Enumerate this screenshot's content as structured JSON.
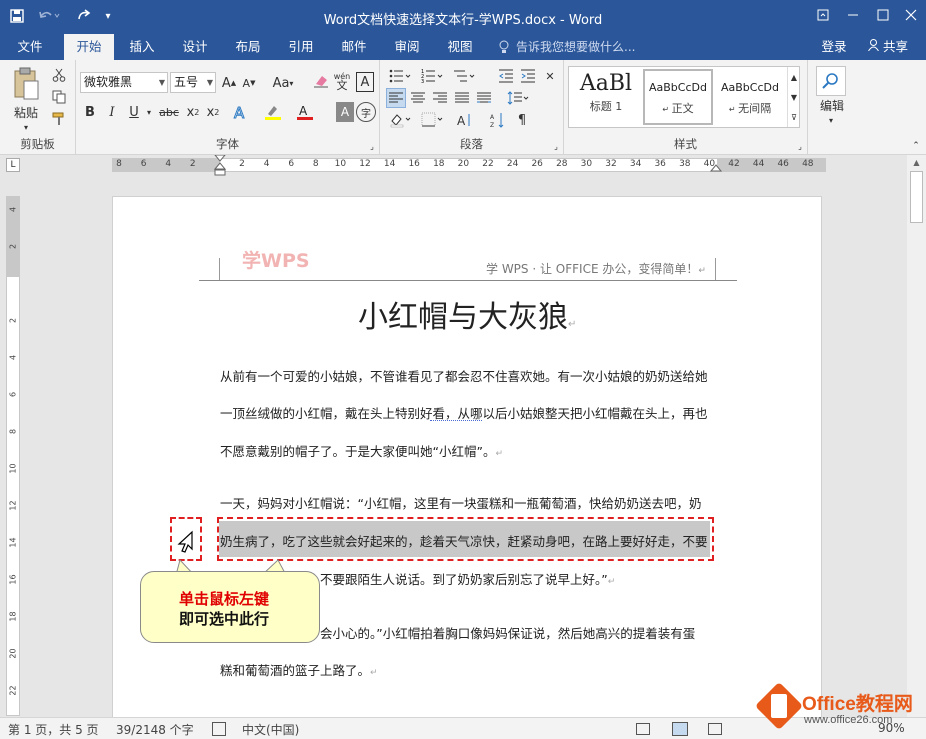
{
  "window": {
    "title": "Word文档快速选择文本行-学WPS.docx - Word"
  },
  "quick_access": {
    "save": "save-icon",
    "undo": "undo-icon",
    "redo": "redo-icon",
    "customize": "customize-icon"
  },
  "window_controls": [
    "restore-ribbon-icon",
    "minimize-icon",
    "maximize-icon",
    "close-icon"
  ],
  "tabs": [
    "文件",
    "开始",
    "插入",
    "设计",
    "布局",
    "引用",
    "邮件",
    "审阅",
    "视图"
  ],
  "tellme": "告诉我您想要做什么...",
  "login": "登录",
  "share": "共享",
  "ribbon": {
    "clipboard": {
      "paste": "粘贴",
      "label": "剪贴板"
    },
    "font": {
      "family": "微软雅黑",
      "size": "五号",
      "grow": "A",
      "shrink": "A",
      "case": "Aa",
      "phonetic": "wén",
      "bold": "B",
      "italic": "I",
      "underline": "U",
      "strike": "abc",
      "sub": "x",
      "sup": "x",
      "label": "字体"
    },
    "paragraph": {
      "label": "段落"
    },
    "styles": {
      "items": [
        {
          "preview": "AaBl",
          "name": "标题 1"
        },
        {
          "preview": "AaBbCcDd",
          "name": "正文"
        },
        {
          "preview": "AaBbCcDd",
          "name": "无间隔"
        }
      ],
      "label": "样式"
    },
    "editing": {
      "label": "编辑"
    }
  },
  "ruler_h": [
    "8",
    "6",
    "4",
    "2",
    "",
    "2",
    "4",
    "6",
    "8",
    "10",
    "12",
    "14",
    "16",
    "18",
    "20",
    "22",
    "24",
    "26",
    "28",
    "30",
    "32",
    "34",
    "36",
    "38",
    "40",
    "42",
    "44",
    "46",
    "48"
  ],
  "ruler_v": [
    "4",
    "2",
    "",
    "2",
    "4",
    "6",
    "8",
    "10",
    "12",
    "14",
    "16",
    "18",
    "20",
    "22"
  ],
  "document": {
    "header_logo": "学WPS",
    "header_slogan": "学 WPS · 让 OFFICE 办公，变得简单！",
    "title": "小红帽与大灰狼",
    "lines": [
      "从前有一个可爱的小姑娘，不管谁看见了都会忍不住喜欢她。有一次小姑娘的奶奶送给她",
      "一顶丝绒做的小红帽，戴在头上特别好看，从哪以后小姑娘整天把小红帽戴在头上，再也",
      "不愿意戴别的帽子了。于是大家便叫她“小红帽”。",
      "一天，妈妈对小红帽说：“小红帽，这里有一块蛋糕和一瓶葡萄酒，快给奶奶送去吧，奶",
      "奶生病了，吃了这些就会好起来的，趁着天气凉快，赶紧动身吧，在路上要好好走，不要",
      "不要跟陌生人说话。到了奶奶家后别忘了说早上好。”",
      "会小心的。”小红帽拍着胸口像妈妈保证说，然后她高兴的提着装有蛋",
      "糕和葡萄酒的篮子上路了。"
    ]
  },
  "callout": {
    "line1": "单击鼠标左键",
    "line2": "即可选中此行"
  },
  "status": {
    "page": "第 1 页，共 5 页",
    "words": "39/2148 个字",
    "lang": "中文(中国)",
    "zoom": "90%"
  },
  "watermark": {
    "brand": "Office教程网",
    "url": "www.office26.com"
  },
  "colors": {
    "titlebar": "#2b579a",
    "selection": "#c8c8c8",
    "highlight_box": "#e02020",
    "callout_title": "#e00000"
  }
}
